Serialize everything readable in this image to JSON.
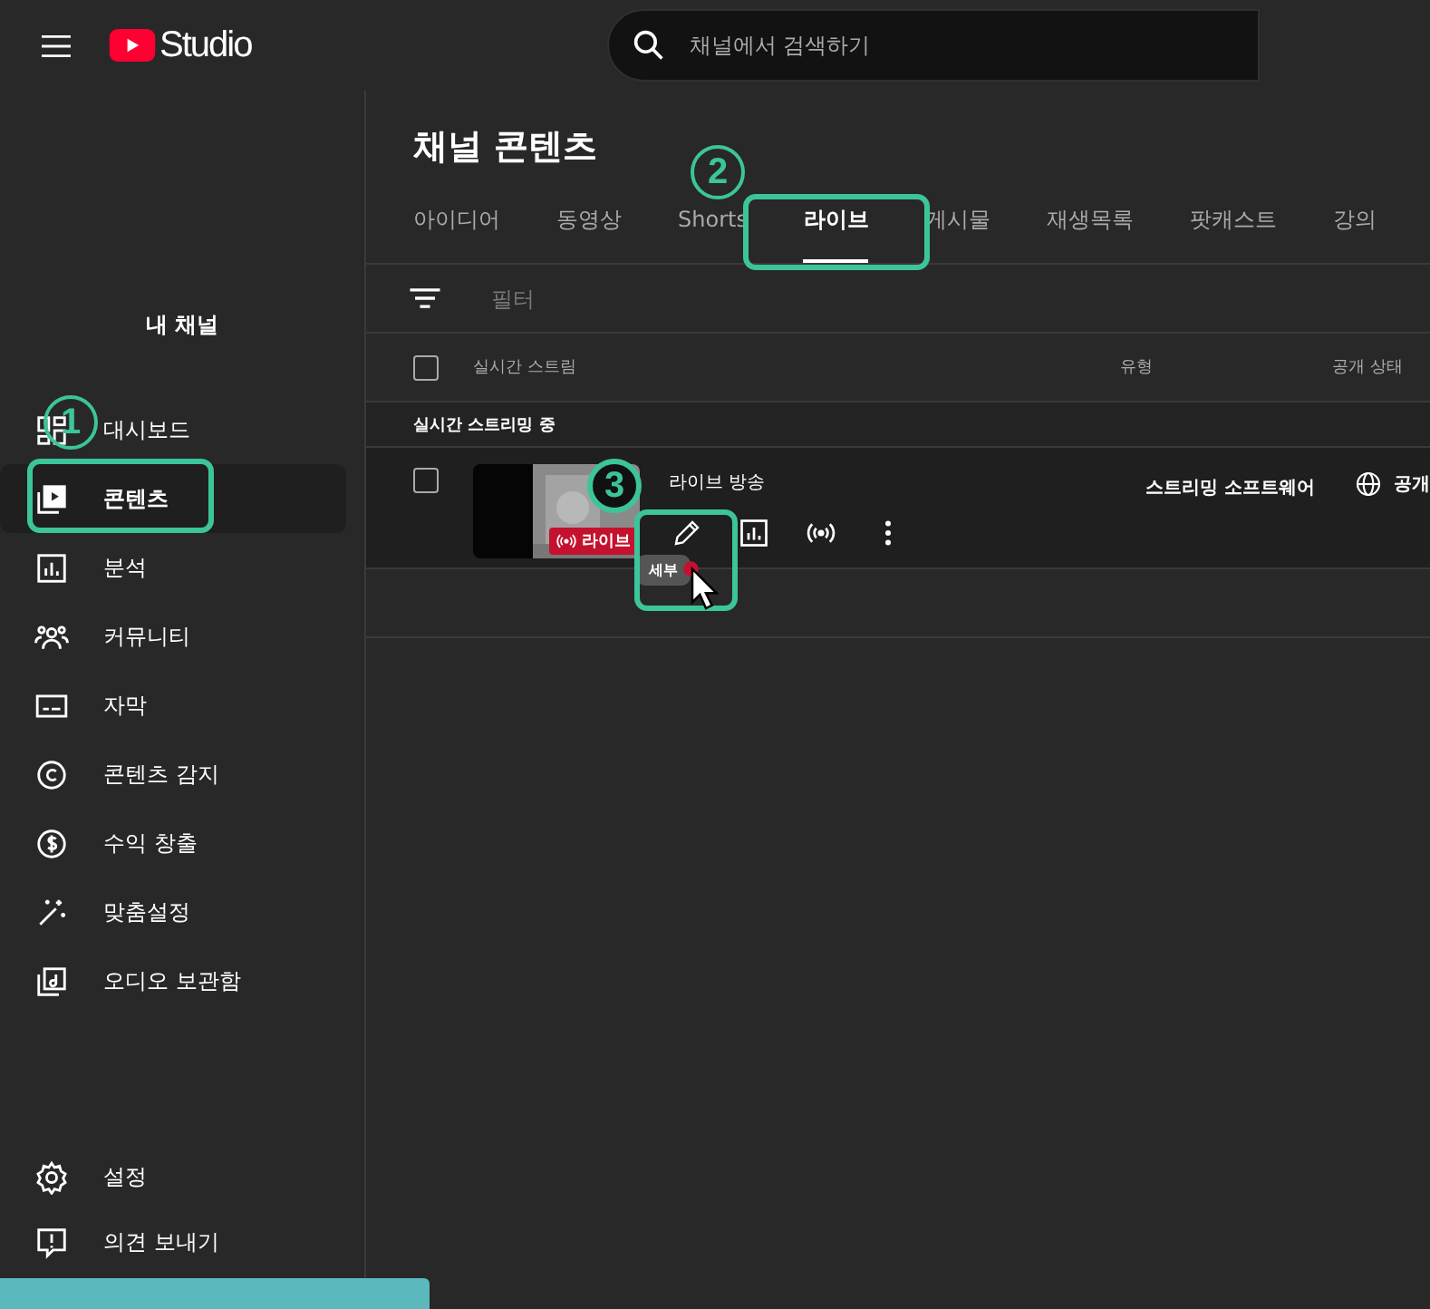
{
  "header": {
    "logo_text": "Studio",
    "search": {
      "placeholder": "채널에서 검색하기"
    }
  },
  "sidebar": {
    "channel_label": "내 채널",
    "items": [
      {
        "label": "대시보드",
        "selected": false
      },
      {
        "label": "콘텐츠",
        "selected": true
      },
      {
        "label": "분석",
        "selected": false
      },
      {
        "label": "커뮤니티",
        "selected": false
      },
      {
        "label": "자막",
        "selected": false
      },
      {
        "label": "콘텐츠 감지",
        "selected": false
      },
      {
        "label": "수익 창출",
        "selected": false
      },
      {
        "label": "맞춤설정",
        "selected": false
      },
      {
        "label": "오디오 보관함",
        "selected": false
      }
    ],
    "footer_items": [
      {
        "label": "설정"
      },
      {
        "label": "의견 보내기"
      }
    ]
  },
  "main": {
    "title": "채널 콘텐츠",
    "tabs": [
      {
        "label": "아이디어",
        "selected": false
      },
      {
        "label": "동영상",
        "selected": false
      },
      {
        "label": "Shorts",
        "selected": false
      },
      {
        "label": "라이브",
        "selected": true
      },
      {
        "label": "게시물",
        "selected": false
      },
      {
        "label": "재생목록",
        "selected": false
      },
      {
        "label": "팟캐스트",
        "selected": false
      },
      {
        "label": "강의",
        "selected": false
      }
    ],
    "filter": {
      "placeholder": "필터"
    },
    "table": {
      "select_all_checked": false,
      "columns": [
        "실시간 스트림",
        "유형",
        "공개 상태"
      ],
      "sections": [
        {
          "title": "실시간 스트리밍 중",
          "rows": [
            {
              "title": "라이브 방송",
              "badge": "라이브",
              "type": "스트리밍 소프트웨어",
              "visibility": "공개",
              "checked": false,
              "tooltip": "세부"
            }
          ]
        }
      ]
    }
  },
  "upload_progress": {
    "level": 0.3
  },
  "annotations": [
    {
      "number": "1"
    },
    {
      "number": "2"
    },
    {
      "number": "3"
    }
  ]
}
